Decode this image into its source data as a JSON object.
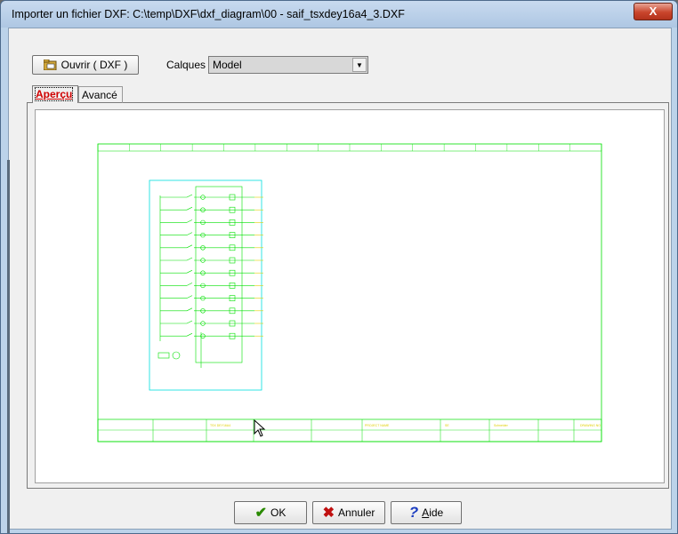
{
  "window": {
    "title": "Importer un fichier DXF: C:\\temp\\DXF\\dxf_diagram\\00 - saif_tsxdey16a4_3.DXF",
    "close_glyph": "X"
  },
  "toolbar": {
    "open_label": "Ouvrir ( DXF )",
    "calques_label": "Calques",
    "calques_value": "Model"
  },
  "tabs": [
    {
      "label": "Aperçu",
      "active": true
    },
    {
      "label": "Avancé",
      "active": false
    }
  ],
  "drawing": {
    "sheet_title": "Modul pro TSX DEY 16A4",
    "caption": "TSX - Tension NATL - schema sample",
    "stroke_color": "#00e000",
    "frame_color": "#00e0e0",
    "text_color": "#e0d000",
    "title_block": [
      "TSX DEY16A4",
      "PROJECT NAME",
      "SE",
      "Schneider",
      "DRAWING NO"
    ]
  },
  "footer": {
    "ok_label": "OK",
    "cancel_label": "Annuler",
    "help_label": "Aide"
  },
  "icons": {
    "open": "folder-open-icon",
    "ok": "checkmark-icon",
    "cancel": "red-x-icon",
    "help": "question-mark-icon"
  }
}
